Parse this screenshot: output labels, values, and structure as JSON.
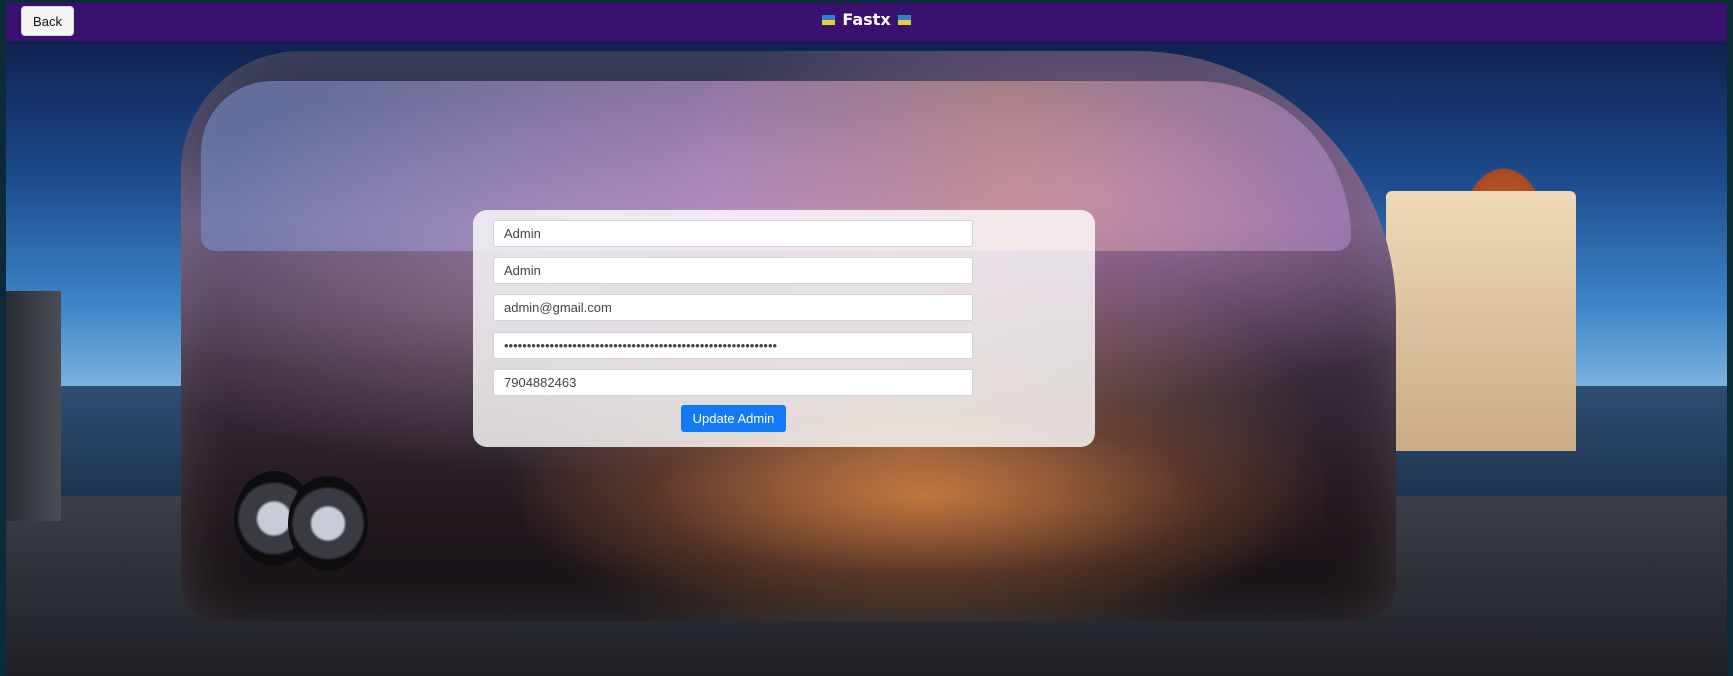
{
  "navbar": {
    "back_label": "Back",
    "brand": "Fastx",
    "flag_icon": "ukraine-flag-icon"
  },
  "form": {
    "first_name": "Admin",
    "last_name": "Admin",
    "email": "admin@gmail.com",
    "password": "••••••••••••••••••••••••••••••••••••••••••••••••••••••••••••",
    "phone": "7904882463",
    "submit_label": "Update Admin"
  },
  "colors": {
    "navbar_bg": "#3a1170",
    "primary_button": "#1479f5"
  }
}
